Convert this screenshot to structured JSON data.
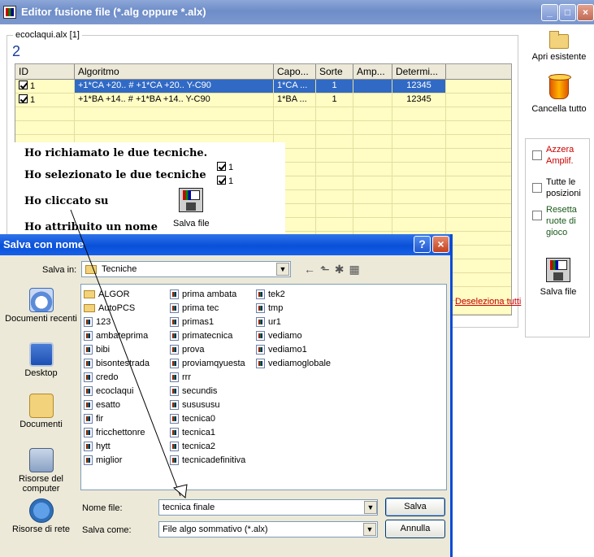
{
  "window": {
    "title": "Editor fusione file (*.alg oppure *.alx)",
    "controls": {
      "minimize": "_",
      "maximize": "□",
      "close": "×"
    }
  },
  "group": {
    "legend": "ecoclaqui.alx    [1]",
    "count": "2"
  },
  "grid": {
    "columns": [
      "ID",
      "Algoritmo",
      "Capo...",
      "Sorte",
      "Amp...",
      "Determi..."
    ],
    "rows": [
      {
        "checked": true,
        "id": "1",
        "algoritmo": "+1*CA +20.. # +1*CA +20.. Y-C90",
        "capo": "1*CA ...",
        "sorte": "1",
        "amp": "",
        "determinazione": "12345",
        "selected": true
      },
      {
        "checked": true,
        "id": "1",
        "algoritmo": "+1*BA +14.. # +1*BA +14.. Y-C90",
        "capo": "1*BA ...",
        "sorte": "1",
        "amp": "",
        "determinazione": "12345",
        "selected": false
      }
    ],
    "deselect_link": "Deseleziona tutti"
  },
  "side": {
    "apri": "Apri esistente",
    "cancella": "Cancella tutto",
    "options": [
      {
        "label": "Azzera Amplif.",
        "color": "#cc0000"
      },
      {
        "label": "Tutte le posizioni",
        "color": "#000000"
      },
      {
        "label": "Resetta ruote di gioco",
        "color": "#1a5a1a"
      }
    ],
    "salva": "Salva file"
  },
  "annotation": {
    "lines": [
      "Ho richiamato le due tecniche.",
      "Ho selezionato le due tecniche",
      "Ho cliccato su",
      "Ho attribuito un nome"
    ],
    "checks": [
      "1",
      "1"
    ],
    "salva_file": "Salva file"
  },
  "dialog": {
    "title": "Salva con nome",
    "help": "?",
    "close": "×",
    "save_in_label": "Salva in:",
    "save_in_value": "Tecniche",
    "places": [
      "Documenti recenti",
      "Desktop",
      "Documenti",
      "Risorse del computer",
      "Risorse di rete"
    ],
    "files_col1": [
      {
        "name": "ALGOR",
        "type": "folder"
      },
      {
        "name": "AutoPCS",
        "type": "folder"
      },
      {
        "name": "123",
        "type": "file"
      },
      {
        "name": "ambateprima",
        "type": "file"
      },
      {
        "name": "bibi",
        "type": "file"
      },
      {
        "name": "bisontestrada",
        "type": "file"
      },
      {
        "name": "credo",
        "type": "file"
      },
      {
        "name": "ecoclaqui",
        "type": "file"
      },
      {
        "name": "esatto",
        "type": "file"
      },
      {
        "name": "fir",
        "type": "file"
      },
      {
        "name": "fricchettonre",
        "type": "file"
      },
      {
        "name": "hytt",
        "type": "file"
      },
      {
        "name": "miglior",
        "type": "file"
      }
    ],
    "files_col2": [
      "prima ambata",
      "prima tec",
      "primas1",
      "primatecnica",
      "prova",
      "proviamqyuesta",
      "rrr",
      "secundis",
      "susususu",
      "tecnica0",
      "tecnica1",
      "tecnica2",
      "tecnicadefinitiva"
    ],
    "files_col3": [
      "tek2",
      "tmp",
      "ur1",
      "vediamo",
      "vediamo1",
      "vediamoglobale"
    ],
    "filename_label": "Nome file:",
    "filename_value": "tecnica finale",
    "savetype_label": "Salva come:",
    "savetype_value": "File algo sommativo (*.alx)",
    "save_button": "Salva",
    "cancel_button": "Annulla"
  }
}
